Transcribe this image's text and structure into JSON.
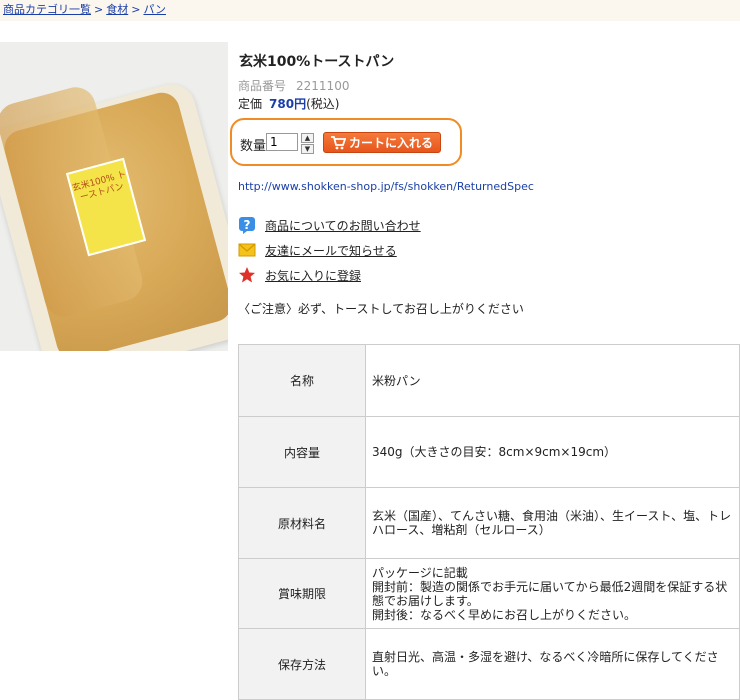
{
  "breadcrumb": {
    "items": [
      "商品カテゴリ一覧",
      "食材",
      "パン"
    ],
    "separator": ">"
  },
  "product": {
    "title": "玄米100%トーストパン",
    "sku_label": "商品番号",
    "sku": "2211100",
    "price_label": "定価",
    "price": "780円",
    "tax_note": "(税込)",
    "package_text": "玄米100% トーストパン"
  },
  "cart": {
    "qty_label": "数量",
    "qty_value": "1",
    "button_label": "カートに入れる"
  },
  "return_url": "http://www.shokken-shop.jp/fs/shokken/ReturnedSpec",
  "actions": [
    {
      "label": "商品についてのお問い合わせ",
      "icon": "question-icon"
    },
    {
      "label": "友達にメールで知らせる",
      "icon": "mail-icon"
    },
    {
      "label": "お気に入りに登録",
      "icon": "star-icon"
    }
  ],
  "caution": "〈ご注意〉必ず、トーストしてお召し上がりください",
  "spec": [
    {
      "name": "名称",
      "value": "米粉パン"
    },
    {
      "name": "内容量",
      "value": "340g（大きさの目安：8cm×9cm×19cm）"
    },
    {
      "name": "原材料名",
      "value": "玄米（国産）、てんさい糖、食用油（米油）、生イースト、塩、トレハロース、増粘剤（セルロース）"
    },
    {
      "name": "賞味期限",
      "value": "パッケージに記載\n開封前：製造の関係でお手元に届いてから最低2週間を保証する状態でお届けします。\n開封後：なるべく早めにお召し上がりください。"
    },
    {
      "name": "保存方法",
      "value": "直射日光、高温・多湿を避け、なるべく冷暗所に保存してください。"
    }
  ],
  "colors": {
    "accent": "#f08c24",
    "link": "#1a3fa8",
    "cart_button": "#e8551b"
  }
}
